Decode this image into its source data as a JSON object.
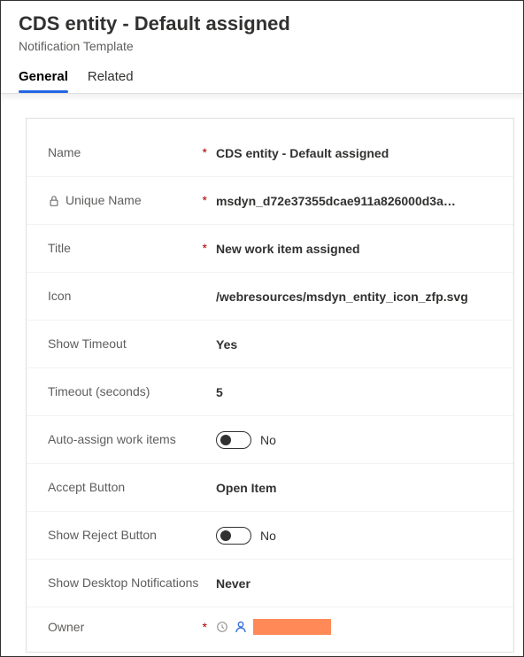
{
  "header": {
    "title": "CDS entity - Default assigned",
    "subtitle": "Notification Template"
  },
  "tabs": {
    "general": "General",
    "related": "Related"
  },
  "fields": {
    "name": {
      "label": "Name",
      "value": "CDS entity - Default assigned",
      "required": true
    },
    "unique_name": {
      "label": "Unique Name",
      "value": "msdyn_d72e37355dcae911a826000d3a…",
      "required": true,
      "locked": true
    },
    "title_field": {
      "label": "Title",
      "value": "New work item assigned",
      "required": true
    },
    "icon": {
      "label": "Icon",
      "value": "/webresources/msdyn_entity_icon_zfp.svg"
    },
    "show_timeout": {
      "label": "Show Timeout",
      "value": "Yes"
    },
    "timeout": {
      "label": "Timeout (seconds)",
      "value": "5"
    },
    "auto_assign": {
      "label": "Auto-assign work items",
      "value": "No"
    },
    "accept_button": {
      "label": "Accept Button",
      "value": "Open Item"
    },
    "show_reject": {
      "label": "Show Reject Button",
      "value": "No"
    },
    "show_desktop": {
      "label": "Show Desktop Notifications",
      "value": "Never"
    },
    "owner": {
      "label": "Owner",
      "required": true
    }
  }
}
